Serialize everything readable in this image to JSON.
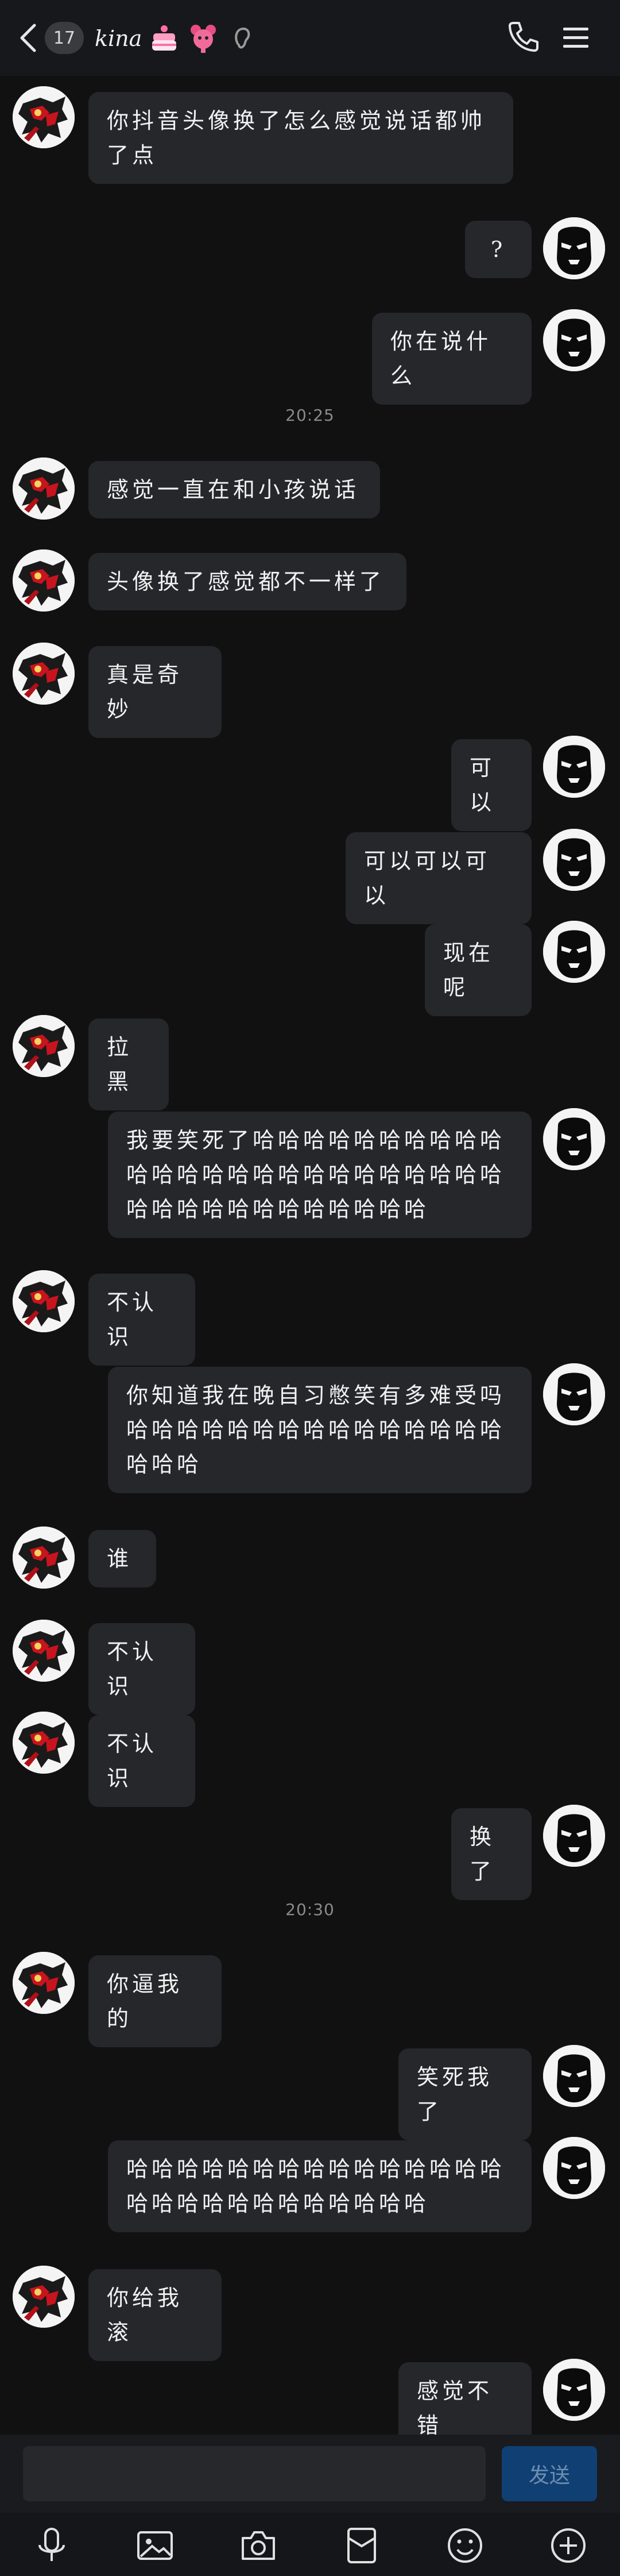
{
  "header": {
    "unread_count": "17",
    "title": "kina",
    "back_icon": "chevron-left-icon",
    "call_icon": "phone-icon",
    "menu_icon": "hamburger-menu-icon"
  },
  "messages": [
    {
      "side": "left",
      "text": "你抖音头像换了怎么感觉说话都帅了点"
    },
    {
      "side": "right",
      "text": "?"
    },
    {
      "side": "right",
      "text": "你在说什么"
    },
    {
      "type": "time",
      "text": "20:25"
    },
    {
      "side": "left",
      "text": "感觉一直在和小孩说话"
    },
    {
      "side": "left",
      "text": "头像换了感觉都不一样了"
    },
    {
      "side": "left",
      "text": "真是奇妙"
    },
    {
      "side": "right",
      "text": "可以"
    },
    {
      "side": "right",
      "text": "可以可以可以"
    },
    {
      "side": "right",
      "text": "现在呢"
    },
    {
      "side": "left",
      "text": "拉黑"
    },
    {
      "side": "right",
      "text": "我要笑死了哈哈哈哈哈哈哈哈哈哈哈哈哈哈哈哈哈哈哈哈哈哈哈哈哈哈哈哈哈哈哈哈哈哈哈哈哈"
    },
    {
      "side": "left",
      "text": "不认识"
    },
    {
      "side": "right",
      "text": "你知道我在晚自习憋笑有多难受吗哈哈哈哈哈哈哈哈哈哈哈哈哈哈哈哈哈哈"
    },
    {
      "side": "left",
      "text": "谁"
    },
    {
      "side": "left",
      "text": "不认识"
    },
    {
      "side": "left",
      "text": "不认识"
    },
    {
      "side": "right",
      "text": "换了"
    },
    {
      "type": "time",
      "text": "20:30"
    },
    {
      "side": "left",
      "text": "你逼我的"
    },
    {
      "side": "right",
      "text": "笑死我了"
    },
    {
      "side": "right",
      "text": "哈哈哈哈哈哈哈哈哈哈哈哈哈哈哈哈哈哈哈哈哈哈哈哈哈哈哈"
    },
    {
      "side": "left",
      "text": "你给我滚"
    },
    {
      "side": "right",
      "text": "感觉不错"
    }
  ],
  "input": {
    "placeholder": "",
    "send_label": "发送"
  },
  "toolbar": {
    "items": [
      "microphone-icon",
      "image-icon",
      "camera-icon",
      "red-envelope-icon",
      "emoji-icon",
      "plus-icon"
    ]
  },
  "colors": {
    "background": "#111112",
    "bubble": "#25272b",
    "send_button": "#0f3f73"
  }
}
